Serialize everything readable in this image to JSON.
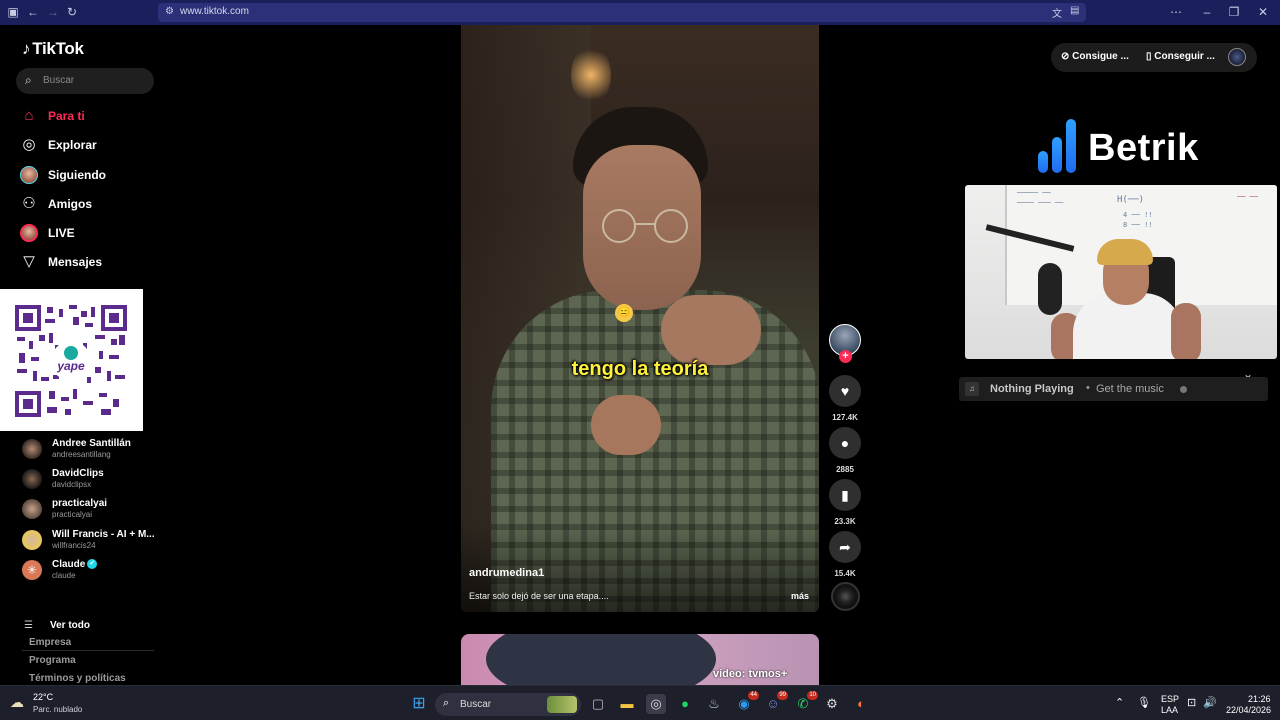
{
  "browser": {
    "url": "www.tiktok.com"
  },
  "sidebar": {
    "logo": "TikTok",
    "search_placeholder": "Buscar",
    "nav": [
      {
        "label": "Para ti",
        "icon": "home-icon",
        "active": true
      },
      {
        "label": "Explorar",
        "icon": "compass-icon"
      },
      {
        "label": "Siguiendo",
        "icon": "following-avatar"
      },
      {
        "label": "Amigos",
        "icon": "friends-icon"
      },
      {
        "label": "LIVE",
        "icon": "live-avatar"
      },
      {
        "label": "Mensajes",
        "icon": "paper-plane-icon"
      }
    ],
    "following": [
      {
        "name": "Andree Santillán",
        "handle": "andreesantillang"
      },
      {
        "name": "DavidClips",
        "handle": "davidclipsx"
      },
      {
        "name": "practicalyai",
        "handle": "practicalyai"
      },
      {
        "name": "Will Francis - AI + M...",
        "handle": "willfrancis24"
      },
      {
        "name": "Claude",
        "handle": "claude",
        "verified": true
      }
    ],
    "see_all": "Ver todo",
    "footer": [
      "Empresa",
      "Programa",
      "Términos y políticas"
    ]
  },
  "qr": {
    "brand": "yape"
  },
  "video": {
    "caption": "tengo la teoría",
    "author": "andrumedina1",
    "description": "Estar solo dejó de ser una etapa....",
    "more": "más",
    "actions": {
      "likes": "127.4K",
      "comments": "2885",
      "saves": "23.3K",
      "shares": "15.4K"
    }
  },
  "next_video": {
    "watermark": "video: tvmos+"
  },
  "header": {
    "btn1": "Consigue ...",
    "btn2": "Conseguir ..."
  },
  "overlay": {
    "brand": "Betrik",
    "now_playing": "Nothing Playing",
    "get_music": "Get the music"
  },
  "taskbar": {
    "temperature": "22°C",
    "condition": "Parc. nublado",
    "search_placeholder": "Buscar",
    "lang1": "ESP",
    "lang2": "LAA",
    "time": "21:26",
    "date": "22/04/2026",
    "badges": {
      "app1": "44",
      "app2": "99",
      "app3": "10"
    }
  },
  "colors": {
    "accent": "#fe2c55",
    "chrome": "#1b1f5c",
    "brand_blue": "#1f6bf0"
  }
}
